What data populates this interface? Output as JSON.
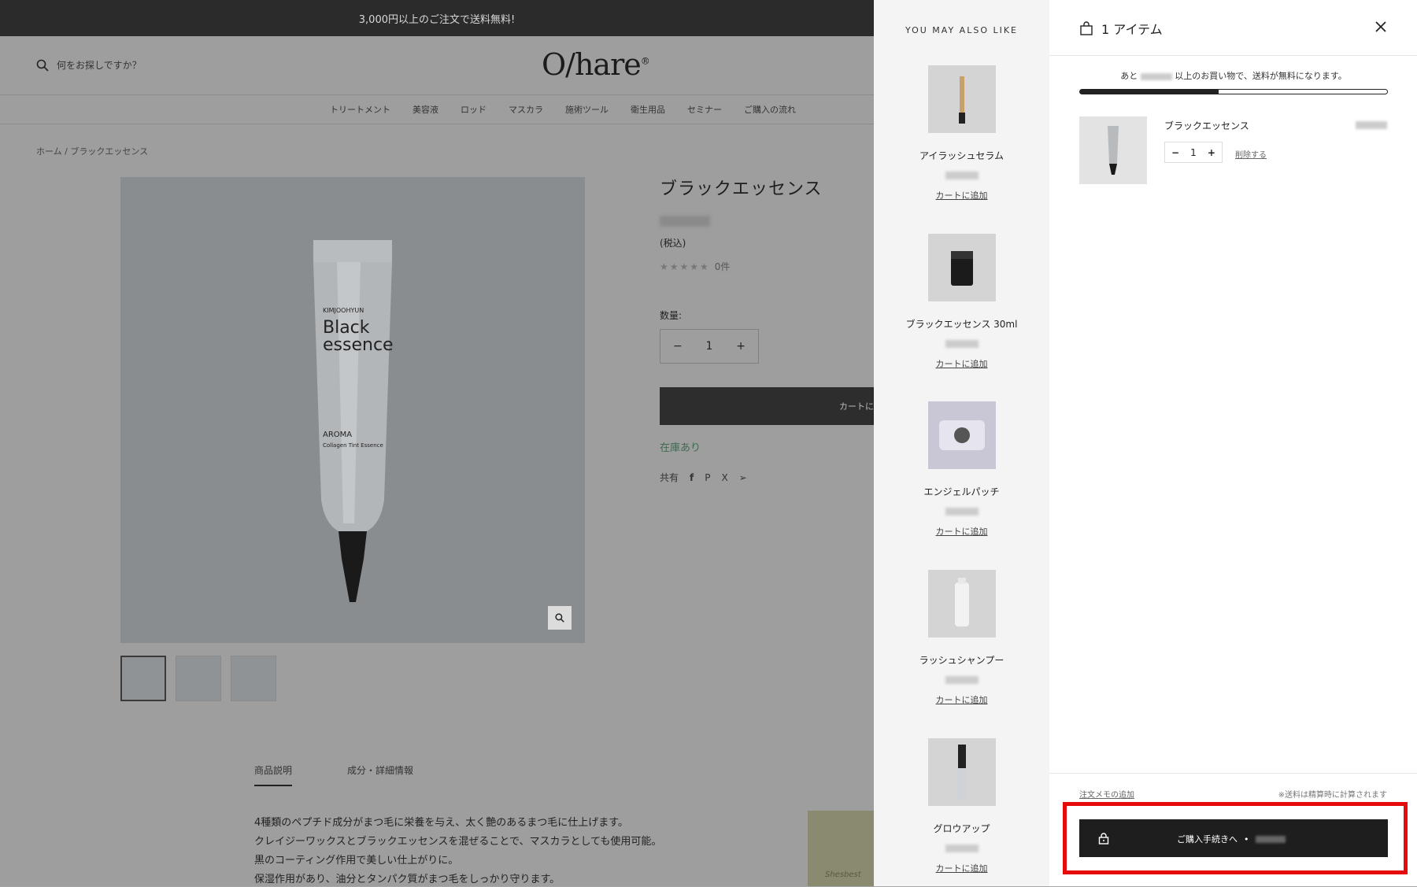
{
  "announcement": "3,000円以上のご注文で送料無料!",
  "search": {
    "placeholder": "何をお探しですか？"
  },
  "logo": "O/hare",
  "nav": [
    "トリートメント",
    "美容液",
    "ロッド",
    "マスカラ",
    "施術ツール",
    "衛生用品",
    "セミナー",
    "ご購入の流れ"
  ],
  "breadcrumb": {
    "home": "ホーム",
    "current": "ブラックエッセンス"
  },
  "tube_text": {
    "brand": "KIMJOOHYUN",
    "line1": "Black",
    "line2": "essence",
    "sub1": "AROMA",
    "sub2": "Collagen Tint Essence"
  },
  "product": {
    "title": "ブラックエッセンス",
    "tax_note": "(税込)",
    "rating_stars": "★★★★★",
    "review_count": "0件",
    "qty_label": "数量:",
    "qty": "1",
    "add_to_cart": "カートに",
    "stock": "在庫あり",
    "share": "共有"
  },
  "tabs": [
    "商品説明",
    "成分・詳細情報"
  ],
  "description": [
    "4種類のペプチド成分がまつ毛に栄養を与え、太く艶のあるまつ毛に仕上げます。",
    "クレイジーワックスとブラックエッセンスを混ぜることで、マスカラとしても使用可能。",
    "黒のコーティング作用で美しい仕上がりに。",
    "保湿作用があり、油分とタンパク質がまつ毛をしっかり守ります。"
  ],
  "desc_image_text": "Shesbest",
  "recs": {
    "title": "YOU MAY ALSO LIKE",
    "add_label": "カートに追加",
    "items": [
      {
        "name": "アイラッシュセラム"
      },
      {
        "name": "ブラックエッセンス 30ml"
      },
      {
        "name": "エンジェルパッチ"
      },
      {
        "name": "ラッシュシャンプー"
      },
      {
        "name": "グロウアップ"
      }
    ]
  },
  "cart": {
    "title": "1 アイテム",
    "ship_msg_pre": "あと",
    "ship_msg_post": "以上のお買い物で、送料が無料になります。",
    "progress": 0.45,
    "item": {
      "name": "ブラックエッセンス",
      "qty": "1",
      "remove": "削除する"
    },
    "note_link": "注文メモの追加",
    "ship_note": "※送料は精算時に計算されます",
    "checkout_label": "ご購入手続きへ",
    "checkout_sep": "•"
  },
  "colors": {
    "highlight": "#e50b0b",
    "stock_green": "#3f6a50"
  }
}
